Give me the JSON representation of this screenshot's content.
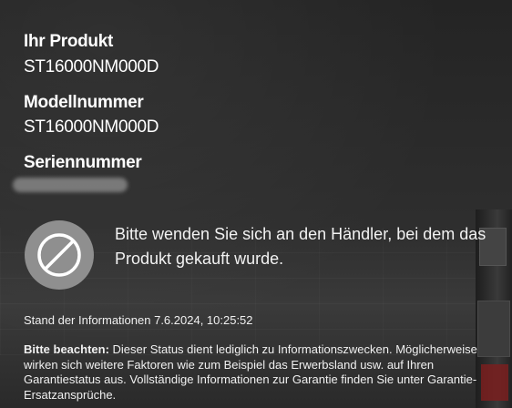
{
  "product": {
    "label": "Ihr Produkt",
    "value": "ST16000NM000D"
  },
  "model": {
    "label": "Modellnummer",
    "value": "ST16000NM000D"
  },
  "serial": {
    "label": "Seriennummer",
    "value_redacted": true
  },
  "status": {
    "icon": "prohibited-icon",
    "message": "Bitte wenden Sie sich an den Händler, bei dem das Produkt gekauft wurde."
  },
  "info_timestamp": "Stand der Informationen 7.6.2024, 10:25:52",
  "notice": {
    "lead": "Bitte beachten:",
    "text": " Dieser Status dient lediglich zu Informationszwecken. Möglicherweise wirken sich weitere Faktoren wie zum Beispiel das Erwerbsland usw. auf Ihren Garantiestatus aus. Vollständige Informationen zur Garantie finden Sie unter Garantie-Ersatzansprüche."
  },
  "colors": {
    "background": "#2b2b2b",
    "icon_circle": "#8f8f8f",
    "text": "#ffffff"
  }
}
